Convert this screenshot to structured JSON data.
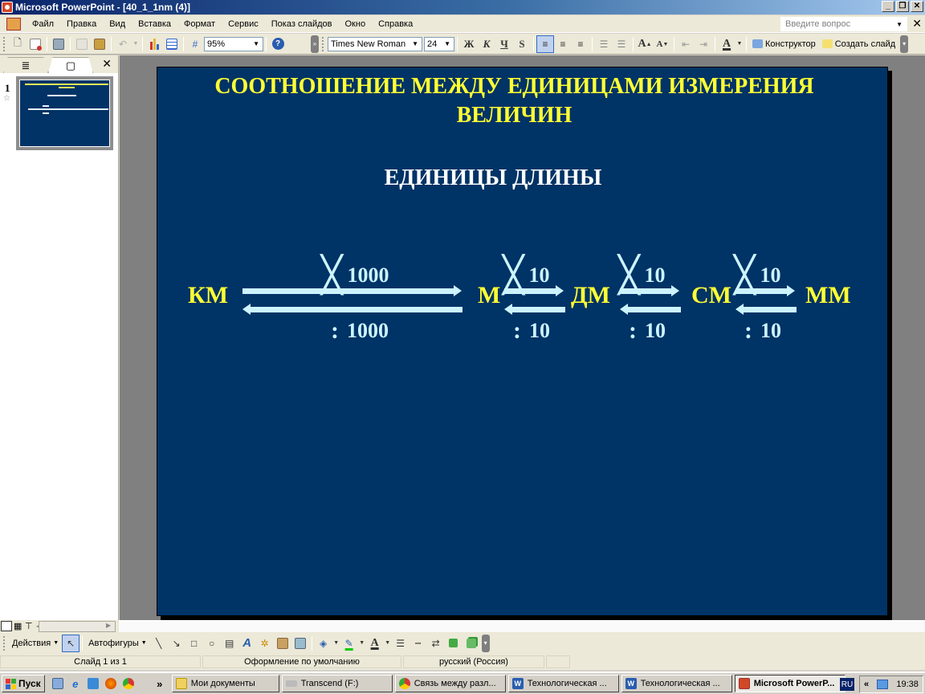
{
  "window": {
    "title": "Microsoft PowerPoint - [40_1_1nm (4)]",
    "buttons": [
      "_",
      "❐",
      "✕"
    ]
  },
  "menubar": {
    "items": [
      "Файл",
      "Правка",
      "Вид",
      "Вставка",
      "Формат",
      "Сервис",
      "Показ слайдов",
      "Окно",
      "Справка"
    ],
    "ask_placeholder": "Введите вопрос",
    "close": "✕"
  },
  "toolbar": {
    "zoom": "95%",
    "font": "Times New Roman",
    "font_size": "24",
    "bold": "Ж",
    "italic": "К",
    "underline": "Ч",
    "shadow": "S",
    "designer": "Конструктор",
    "new_slide": "Создать слайд"
  },
  "left_panel": {
    "tab_outline": "≣",
    "tab_slides": "▢",
    "close": "✕",
    "slide_number": "1",
    "slide_star": "☆"
  },
  "slide": {
    "title": "СООТНОШЕНИЕ МЕЖДУ ЕДИНИЦАМИ ИЗМЕРЕНИЯ ВЕЛИЧИН",
    "subtitle": "ЕДИНИЦЫ ДЛИНЫ",
    "units": [
      "КМ",
      "М",
      "ДМ",
      "СМ",
      "ММ"
    ],
    "conversions": [
      {
        "from": "КМ",
        "to": "М",
        "multiply": "1000",
        "divide": "1000"
      },
      {
        "from": "М",
        "to": "ДМ",
        "multiply": "10",
        "divide": "10"
      },
      {
        "from": "ДМ",
        "to": "СМ",
        "multiply": "10",
        "divide": "10"
      },
      {
        "from": "СМ",
        "to": "ММ",
        "multiply": "10",
        "divide": "10"
      }
    ],
    "multiply_sign": "╳",
    "divide_sign": ":",
    "colors": {
      "background": "#003366",
      "title": "#ffff33",
      "arrows": "#ccf4ff"
    }
  },
  "drawing_toolbar": {
    "actions": "Действия",
    "autoshapes": "Автофигуры"
  },
  "statusbar": {
    "slide": "Слайд 1 из 1",
    "design": "Оформление по умолчанию",
    "language": "русский (Россия)"
  },
  "taskbar": {
    "start": "Пуск",
    "more": "»",
    "tasks": [
      {
        "label": "Мои документы",
        "icon": "folder-icon"
      },
      {
        "label": "Transcend (F:)",
        "icon": "drive-icon"
      },
      {
        "label": "Связь между разл...",
        "icon": "chrome-icon"
      },
      {
        "label": "Технологическая ...",
        "icon": "word-icon"
      },
      {
        "label": "Технологическая ...",
        "icon": "word-icon"
      },
      {
        "label": "Microsoft PowerP...",
        "icon": "powerpoint-icon",
        "active": true
      }
    ],
    "lang": "RU",
    "tray_expand": "«",
    "clock": "19:38"
  }
}
